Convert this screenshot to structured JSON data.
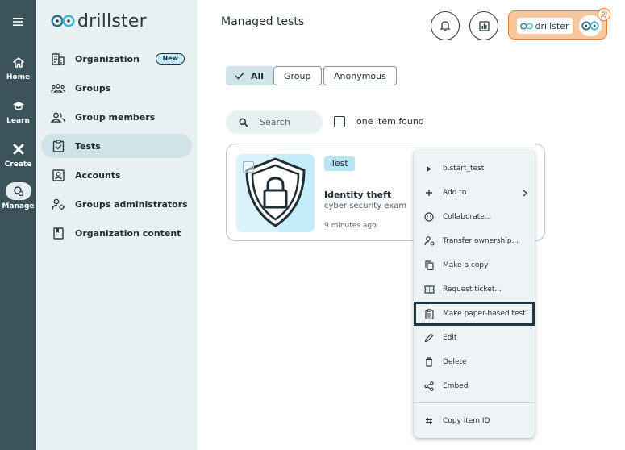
{
  "rail": {
    "items": [
      {
        "label": "Home",
        "icon": "home-icon"
      },
      {
        "label": "Learn",
        "icon": "graduation-cap-icon"
      },
      {
        "label": "Create",
        "icon": "puzzle-icon"
      },
      {
        "label": "Manage",
        "icon": "gear-user-icon"
      }
    ]
  },
  "sidebar": {
    "logo_text": "drillster",
    "items": [
      {
        "label": "Organization",
        "icon": "building-icon",
        "badge": "New"
      },
      {
        "label": "Groups",
        "icon": "groups-icon"
      },
      {
        "label": "Group members",
        "icon": "group-members-icon"
      },
      {
        "label": "Tests",
        "icon": "clipboard-check-icon"
      },
      {
        "label": "Accounts",
        "icon": "account-box-icon"
      },
      {
        "label": "Groups administrators",
        "icon": "admin-gear-icon"
      },
      {
        "label": "Organization content",
        "icon": "book-icon"
      }
    ]
  },
  "header": {
    "title": "Managed tests",
    "brand_logo_text": "drillster"
  },
  "filters": {
    "chips": [
      "All",
      "Group",
      "Anonymous"
    ],
    "selected": "All"
  },
  "search": {
    "placeholder": "Search",
    "result_text": "one item found"
  },
  "card": {
    "tag": "Test",
    "title": "Identity theft",
    "subtitle": "cyber security exam",
    "time": "9 minutes ago"
  },
  "menu": {
    "items": [
      {
        "label": "b.start_test",
        "icon": "play-icon"
      },
      {
        "label": "Add to",
        "icon": "plus-icon",
        "submenu": true
      },
      {
        "label": "Collaborate...",
        "icon": "smiley-icon"
      },
      {
        "label": "Transfer ownership...",
        "icon": "transfer-user-icon"
      },
      {
        "label": "Make a copy",
        "icon": "copy-icon"
      },
      {
        "label": "Request ticket...",
        "icon": "ticket-icon"
      },
      {
        "label": "Make paper-based test...",
        "icon": "clipboard-icon"
      },
      {
        "label": "Edit",
        "icon": "pencil-icon"
      },
      {
        "label": "Delete",
        "icon": "trash-icon"
      },
      {
        "label": "Embed",
        "icon": "share-icon"
      },
      {
        "label": "Copy item ID",
        "icon": "hash-icon"
      }
    ]
  },
  "colors": {
    "rail": "#3c535c",
    "sidebar": "#e8f0f2",
    "accent": "#cfe3e9",
    "brand_orange": "#f6c79c",
    "focus_outline": "#1b3942"
  }
}
